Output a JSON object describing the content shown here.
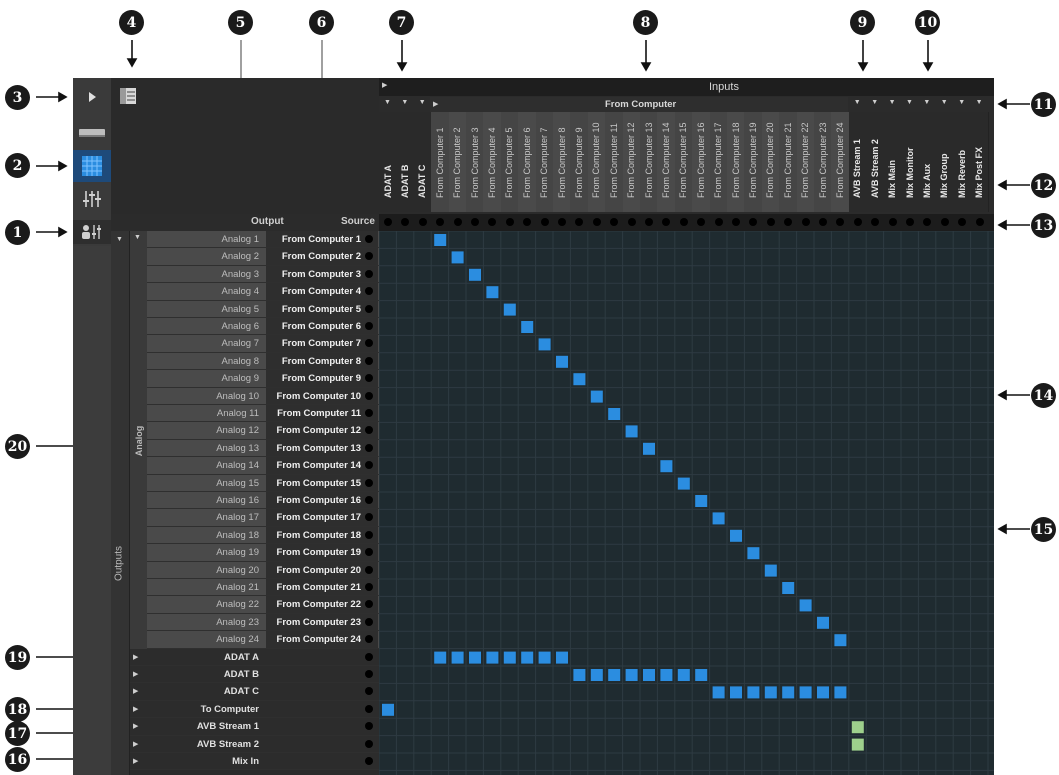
{
  "callouts": [
    "1",
    "2",
    "3",
    "4",
    "5",
    "6",
    "7",
    "8",
    "9",
    "10",
    "11",
    "12",
    "13",
    "14",
    "15",
    "16",
    "17",
    "18",
    "19",
    "20"
  ],
  "header": {
    "inputs_label": "Inputs",
    "from_computer_label": "From Computer",
    "output_label": "Output",
    "source_label": "Source"
  },
  "group_labels": {
    "outputs": "Outputs",
    "analog": "Analog"
  },
  "columns": {
    "adat": [
      "ADAT A",
      "ADAT B",
      "ADAT C"
    ],
    "from_computer": [
      "From Computer 1",
      "From Computer 2",
      "From Computer 3",
      "From Computer 4",
      "From Computer 5",
      "From Computer 6",
      "From Computer 7",
      "From Computer 8",
      "From Computer 9",
      "From Computer 10",
      "From Computer 11",
      "From Computer 12",
      "From Computer 13",
      "From Computer 14",
      "From Computer 15",
      "From Computer 16",
      "From Computer 17",
      "From Computer 18",
      "From Computer 19",
      "From Computer 20",
      "From Computer 21",
      "From Computer 22",
      "From Computer 23",
      "From Computer 24"
    ],
    "tail": [
      "AVB Stream 1",
      "AVB Stream 2",
      "Mix Main",
      "Mix Monitor",
      "Mix Aux",
      "Mix Group",
      "Mix Reverb",
      "Mix Post FX"
    ]
  },
  "analog_rows": [
    {
      "output": "Analog 1",
      "source": "From Computer 1"
    },
    {
      "output": "Analog 2",
      "source": "From Computer 2"
    },
    {
      "output": "Analog 3",
      "source": "From Computer 3"
    },
    {
      "output": "Analog 4",
      "source": "From Computer 4"
    },
    {
      "output": "Analog 5",
      "source": "From Computer 5"
    },
    {
      "output": "Analog 6",
      "source": "From Computer 6"
    },
    {
      "output": "Analog 7",
      "source": "From Computer 7"
    },
    {
      "output": "Analog 8",
      "source": "From Computer 8"
    },
    {
      "output": "Analog 9",
      "source": "From Computer 9"
    },
    {
      "output": "Analog 10",
      "source": "From Computer 10"
    },
    {
      "output": "Analog 11",
      "source": "From Computer 11"
    },
    {
      "output": "Analog 12",
      "source": "From Computer 12"
    },
    {
      "output": "Analog 13",
      "source": "From Computer 13"
    },
    {
      "output": "Analog 14",
      "source": "From Computer 14"
    },
    {
      "output": "Analog 15",
      "source": "From Computer 15"
    },
    {
      "output": "Analog 16",
      "source": "From Computer 16"
    },
    {
      "output": "Analog 17",
      "source": "From Computer 17"
    },
    {
      "output": "Analog 18",
      "source": "From Computer 18"
    },
    {
      "output": "Analog 19",
      "source": "From Computer 19"
    },
    {
      "output": "Analog 20",
      "source": "From Computer 20"
    },
    {
      "output": "Analog 21",
      "source": "From Computer 21"
    },
    {
      "output": "Analog 22",
      "source": "From Computer 22"
    },
    {
      "output": "Analog 23",
      "source": "From Computer 23"
    },
    {
      "output": "Analog 24",
      "source": "From Computer 24"
    }
  ],
  "group_rows": [
    "ADAT A",
    "ADAT B",
    "ADAT C",
    "To Computer",
    "AVB Stream 1",
    "AVB Stream 2",
    "Mix In"
  ],
  "routes": [
    [
      0,
      3
    ],
    [
      1,
      4
    ],
    [
      2,
      5
    ],
    [
      3,
      6
    ],
    [
      4,
      7
    ],
    [
      5,
      8
    ],
    [
      6,
      9
    ],
    [
      7,
      10
    ],
    [
      8,
      11
    ],
    [
      9,
      12
    ],
    [
      10,
      13
    ],
    [
      11,
      14
    ],
    [
      12,
      15
    ],
    [
      13,
      16
    ],
    [
      14,
      17
    ],
    [
      15,
      18
    ],
    [
      16,
      19
    ],
    [
      17,
      20
    ],
    [
      18,
      21
    ],
    [
      19,
      22
    ],
    [
      20,
      23
    ],
    [
      21,
      24
    ],
    [
      22,
      25
    ],
    [
      23,
      26
    ],
    [
      24,
      3
    ],
    [
      24,
      4
    ],
    [
      24,
      5
    ],
    [
      24,
      6
    ],
    [
      24,
      7
    ],
    [
      24,
      8
    ],
    [
      24,
      9
    ],
    [
      24,
      10
    ],
    [
      25,
      11
    ],
    [
      25,
      12
    ],
    [
      25,
      13
    ],
    [
      25,
      14
    ],
    [
      25,
      15
    ],
    [
      25,
      16
    ],
    [
      25,
      17
    ],
    [
      25,
      18
    ],
    [
      26,
      19
    ],
    [
      26,
      20
    ],
    [
      26,
      21
    ],
    [
      26,
      22
    ],
    [
      26,
      23
    ],
    [
      26,
      24
    ],
    [
      26,
      25
    ],
    [
      26,
      26
    ],
    [
      27,
      0
    ],
    [
      28,
      27
    ],
    [
      29,
      27
    ]
  ],
  "colors": {
    "route_blue": "#2b8de0",
    "route_green": "#9ed08c",
    "grid_bg": "#1f2b30",
    "grid_line": "#2e3b42"
  }
}
